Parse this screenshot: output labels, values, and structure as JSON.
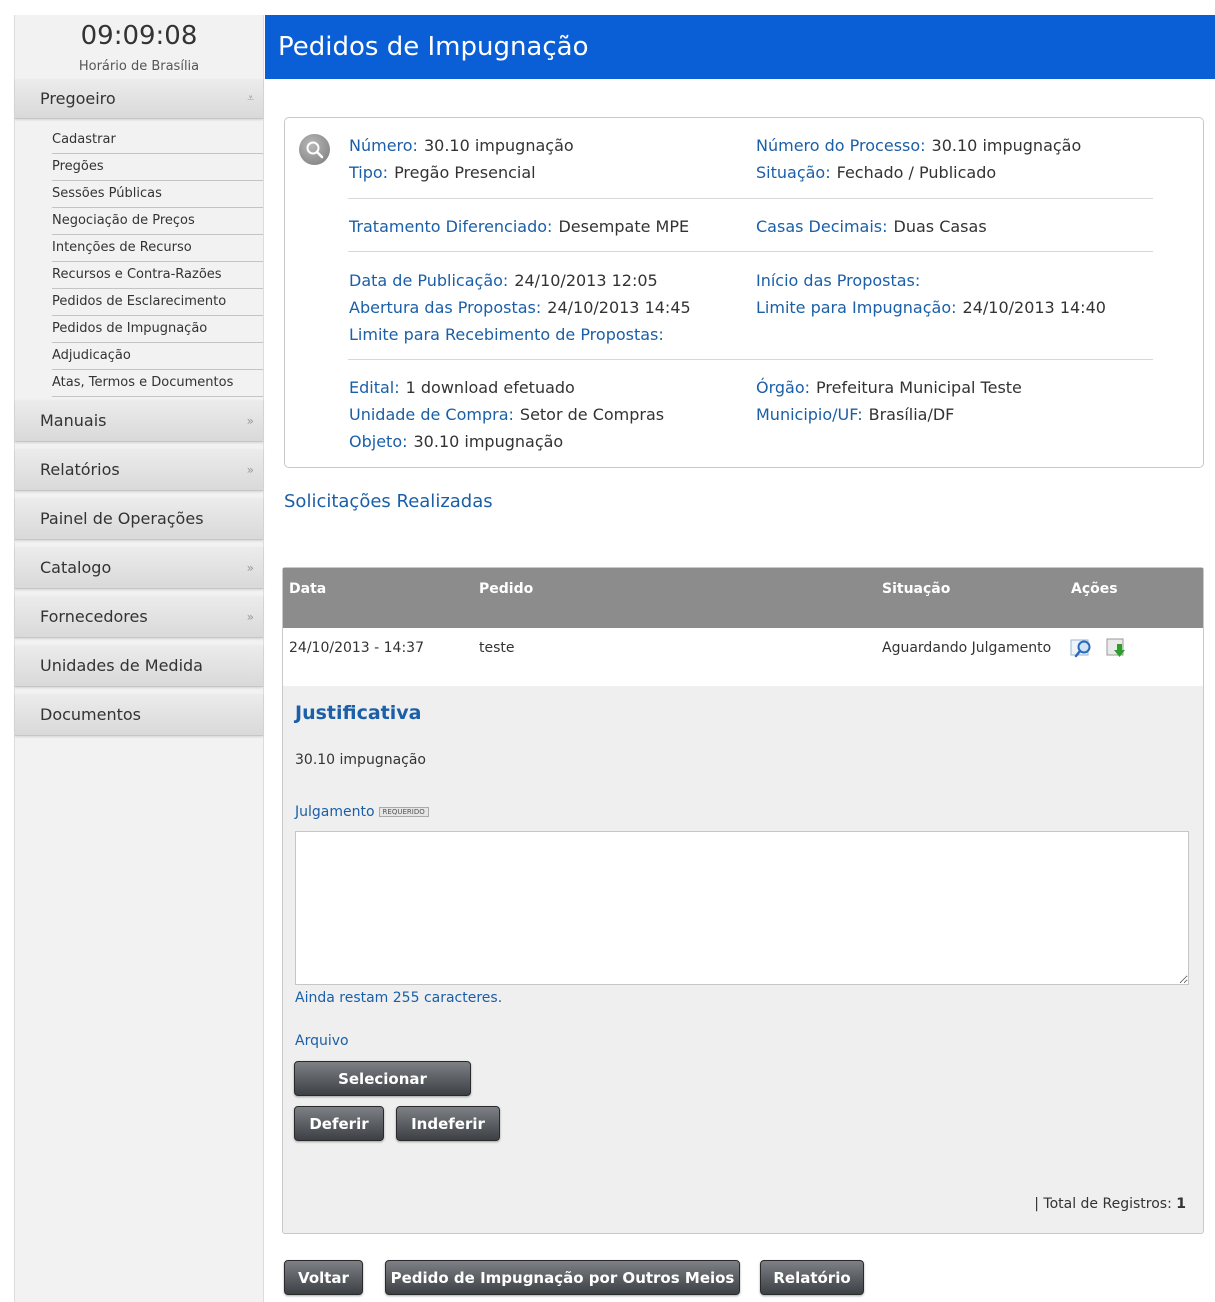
{
  "clock": {
    "time": "09:09:08",
    "label": "Horário de Brasília"
  },
  "sidebar": {
    "pregoeiro": {
      "label": "Pregoeiro",
      "icon": "double-chevron-down-icon"
    },
    "sub_items": [
      "Cadastrar",
      "Pregões",
      "Sessões Públicas",
      "Negociação de Preços",
      "Intenções de Recurso",
      "Recursos e Contra-Razões",
      "Pedidos de Esclarecimento",
      "Pedidos de Impugnação",
      "Adjudicação",
      "Atas, Termos e Documentos"
    ],
    "menus": [
      {
        "label": "Manuais",
        "arrow": "»"
      },
      {
        "label": "Relatórios",
        "arrow": "»"
      },
      {
        "label": "Painel de Operações",
        "arrow": ""
      },
      {
        "label": "Catalogo",
        "arrow": "»"
      },
      {
        "label": "Fornecedores",
        "arrow": "»"
      },
      {
        "label": "Unidades de Medida",
        "arrow": ""
      },
      {
        "label": "Documentos",
        "arrow": ""
      }
    ]
  },
  "page_title": "Pedidos de Impugnação",
  "info": {
    "numero": {
      "label": "Número:",
      "value": "30.10 impugnação"
    },
    "tipo": {
      "label": "Tipo:",
      "value": "Pregão Presencial"
    },
    "numero_processo": {
      "label": "Número do Processo:",
      "value": "30.10 impugnação"
    },
    "situacao": {
      "label": "Situação:",
      "value": "Fechado / Publicado"
    },
    "tratamento": {
      "label": "Tratamento Diferenciado:",
      "value": "Desempate MPE"
    },
    "casas": {
      "label": "Casas Decimais:",
      "value": "Duas Casas"
    },
    "data_publicacao": {
      "label": "Data de Publicação:",
      "value": "24/10/2013 12:05"
    },
    "abertura": {
      "label": "Abertura das Propostas:",
      "value": "24/10/2013 14:45"
    },
    "limite_recebimento": {
      "label": "Limite para Recebimento de Propostas:",
      "value": ""
    },
    "inicio_propostas": {
      "label": "Início das Propostas:",
      "value": ""
    },
    "limite_impugnacao": {
      "label": "Limite para Impugnação:",
      "value": "24/10/2013 14:40"
    },
    "edital": {
      "label": "Edital:",
      "value": "1 download efetuado"
    },
    "unidade_compra": {
      "label": "Unidade de Compra:",
      "value": "Setor de Compras"
    },
    "objeto": {
      "label": "Objeto:",
      "value": "30.10 impugnação"
    },
    "orgao": {
      "label": "Órgão:",
      "value": "Prefeitura Municipal Teste"
    },
    "municipio": {
      "label": "Municipio/UF:",
      "value": "Brasília/DF"
    }
  },
  "section_title": "Solicitações Realizadas",
  "table": {
    "headers": {
      "data": "Data",
      "pedido": "Pedido",
      "situacao": "Situação",
      "acoes": "Ações"
    },
    "rows": [
      {
        "data": "24/10/2013 - 14:37",
        "pedido": "teste",
        "situacao": "Aguardando Julgamento"
      }
    ]
  },
  "detail": {
    "justificativa_title": "Justificativa",
    "justificativa_text": "30.10 impugnação",
    "julgamento_label": "Julgamento",
    "required_badge": "REQUERIDO",
    "julgamento_value": "",
    "chars_left": "Ainda restam 255 caracteres.",
    "arquivo_label": "Arquivo",
    "selecionar": "Selecionar",
    "deferir": "Deferir",
    "indeferir": "Indeferir"
  },
  "total": {
    "prefix": "| Total de Registros:",
    "count": "1"
  },
  "footer_buttons": {
    "voltar": "Voltar",
    "outros_meios": "Pedido de Impugnação por Outros Meios",
    "relatorio": "Relatório"
  },
  "colors": {
    "header_blue": "#0a5fd6",
    "link_blue": "#1a5fa8",
    "table_head": "#8c8c8c"
  }
}
